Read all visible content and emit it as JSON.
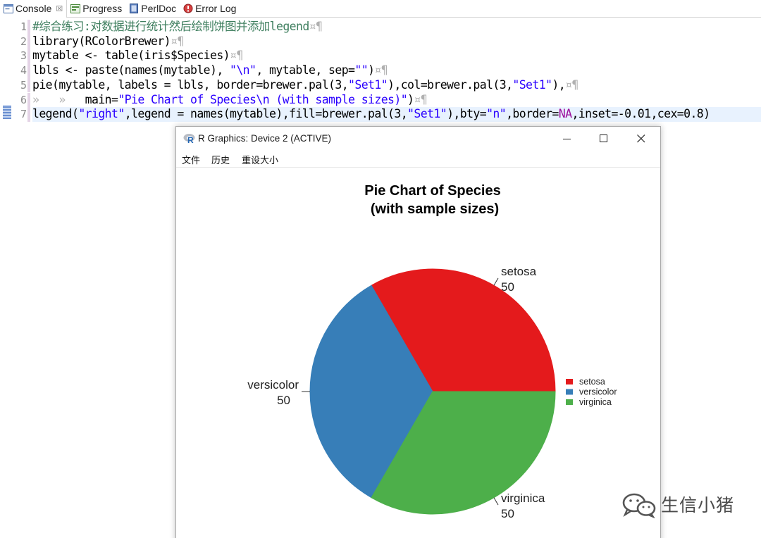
{
  "tabs": [
    {
      "label": "Console",
      "close": "☒",
      "icon": "console-icon",
      "active": true
    },
    {
      "label": "Progress",
      "icon": "progress-icon"
    },
    {
      "label": "PerlDoc",
      "icon": "perldoc-icon"
    },
    {
      "label": "Error Log",
      "icon": "error-log-icon"
    }
  ],
  "editor": {
    "line_numbers": [
      "1",
      "2",
      "3",
      "4",
      "5",
      "6",
      "7"
    ],
    "lines": [
      {
        "comment": "#综合练习:对数据进行统计然后绘制饼图并添加legend",
        "eol": "¤¶"
      },
      {
        "text": "library(RColorBrewer)",
        "eol": "¤¶"
      },
      {
        "text": "mytable <- table(iris$Species)",
        "eol": "¤¶"
      },
      {
        "a": "lbls <- paste(names(mytable), ",
        "s1": "\"\\n\"",
        "b": ", mytable, sep=",
        "s2": "\"\"",
        "c": ")",
        "eol": "¤¶"
      },
      {
        "a": "pie(mytable, labels = lbls, border=brewer.pal(3,",
        "s1": "\"Set1\"",
        "b": "),col=brewer.pal(3,",
        "s2": "\"Set1\"",
        "c": "),",
        "eol": "¤¶"
      },
      {
        "ws": "»   »   ",
        "a": "main=",
        "s1": "\"Pie Chart of Species\\n (with sample sizes)\"",
        "c": ")",
        "eol": "¤¶"
      },
      {
        "a": "legend(",
        "s1": "\"right\"",
        "b": ",legend = names(mytable),fill=brewer.pal(3,",
        "s2": "\"Set1\"",
        "c": "),bty=",
        "s3": "\"n\"",
        "d": ",border=",
        "na": "NA",
        "e": ",inset=-0.01,cex=0.8)"
      }
    ]
  },
  "r_window": {
    "title": "R Graphics: Device 2 (ACTIVE)",
    "menu": [
      "文件",
      "历史",
      "重设大小"
    ],
    "controls": {
      "minimize": "minimize-icon",
      "maximize": "maximize-icon",
      "close": "close-icon"
    }
  },
  "chart_data": {
    "type": "pie",
    "title": "Pie Chart of Species\n(with sample sizes)",
    "title_lines": [
      "Pie Chart of Species",
      "(with sample sizes)"
    ],
    "categories": [
      "setosa",
      "versicolor",
      "virginica"
    ],
    "values": [
      50,
      50,
      50
    ],
    "slice_labels": [
      {
        "name": "setosa",
        "count": "50"
      },
      {
        "name": "versicolor",
        "count": "50"
      },
      {
        "name": "virginica",
        "count": "50"
      }
    ],
    "colors": [
      "#E41A1C",
      "#377EB8",
      "#4DAF4A"
    ],
    "legend": {
      "placement": "right",
      "entries": [
        "setosa",
        "versicolor",
        "virginica"
      ]
    },
    "start_direction": "counterclockwise from 0°"
  },
  "watermark": {
    "text": "生信小猪",
    "icon": "wechat-icon"
  }
}
